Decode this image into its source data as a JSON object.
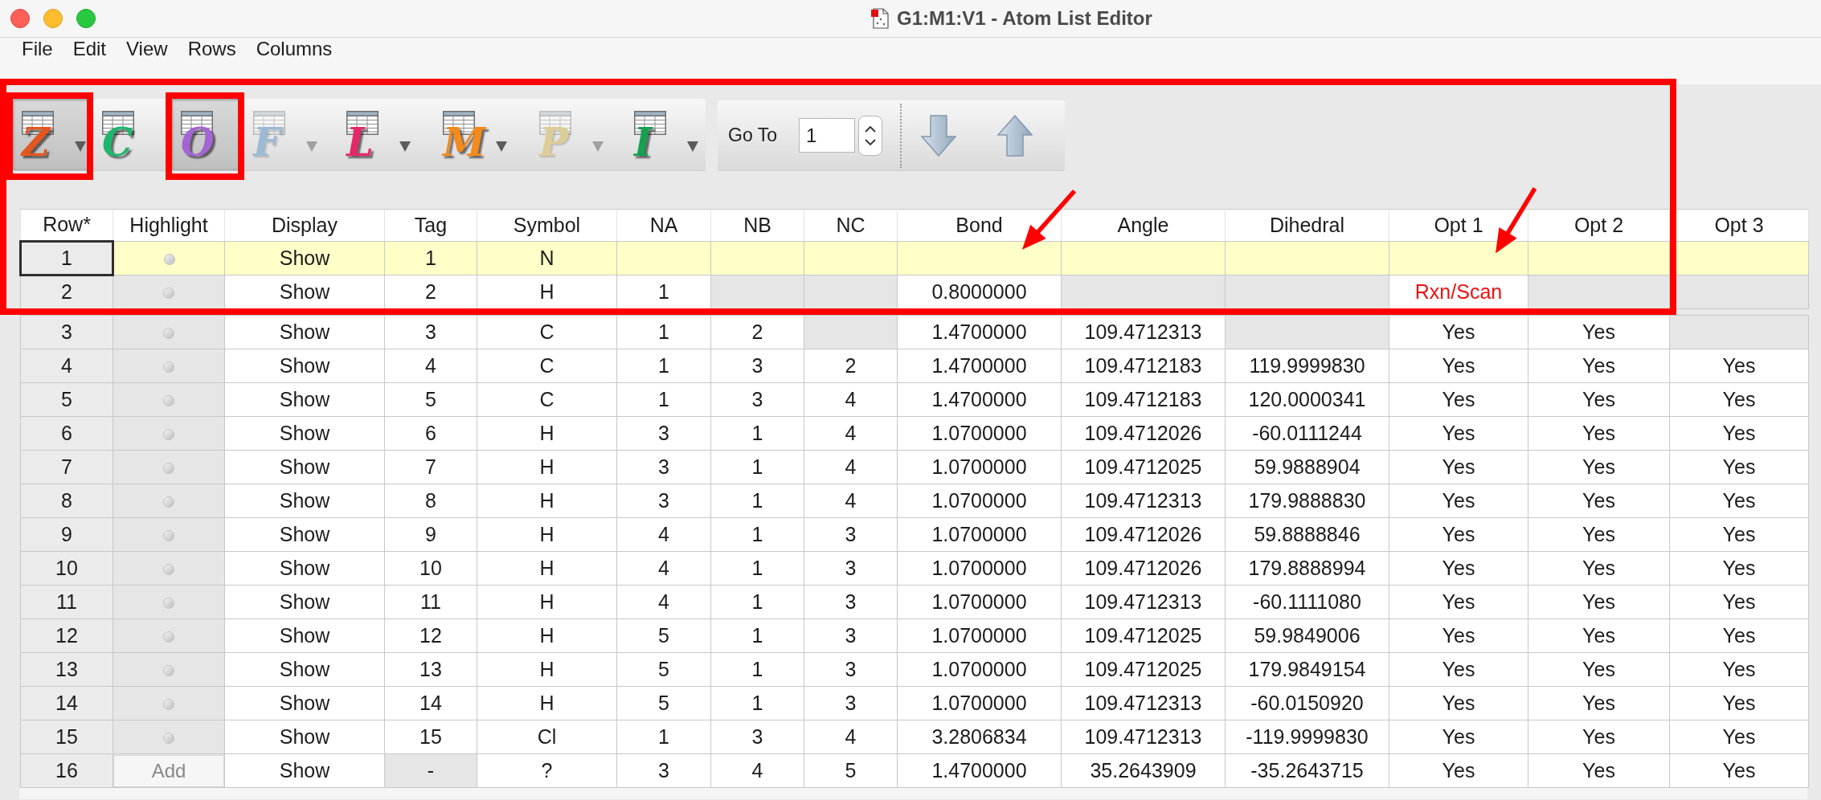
{
  "window": {
    "title": "G1:M1:V1 - Atom List Editor"
  },
  "menu": [
    "File",
    "Edit",
    "View",
    "Rows",
    "Columns"
  ],
  "toolbar": {
    "buttons": [
      {
        "letter": "Z",
        "color": "#e4561f",
        "dropdown": true,
        "pressed": true,
        "disabled": false,
        "annotated": true
      },
      {
        "letter": "C",
        "color": "#1fb56e",
        "dropdown": false,
        "pressed": false,
        "disabled": false,
        "annotated": false
      },
      {
        "letter": "O",
        "color": "#a464d4",
        "dropdown": false,
        "pressed": true,
        "disabled": false,
        "annotated": true
      },
      {
        "letter": "F",
        "color": "#9db9d6",
        "dropdown": true,
        "pressed": false,
        "disabled": true,
        "annotated": false
      },
      {
        "letter": "L",
        "color": "#e6286a",
        "dropdown": true,
        "pressed": false,
        "disabled": false,
        "annotated": false
      },
      {
        "letter": "M",
        "color": "#f28a1c",
        "dropdown": true,
        "pressed": false,
        "disabled": false,
        "annotated": false
      },
      {
        "letter": "P",
        "color": "#dccd96",
        "dropdown": true,
        "pressed": false,
        "disabled": true,
        "annotated": false
      },
      {
        "letter": "I",
        "color": "#17a050",
        "dropdown": true,
        "pressed": false,
        "disabled": false,
        "annotated": false
      }
    ],
    "goto": {
      "label": "Go To",
      "value": "1"
    }
  },
  "table": {
    "columns": [
      "Row*",
      "Highlight",
      "Display",
      "Tag",
      "Symbol",
      "NA",
      "NB",
      "NC",
      "Bond",
      "Angle",
      "Dihedral",
      "Opt 1",
      "Opt 2",
      "Opt 3"
    ],
    "rows": [
      {
        "selected": true,
        "cells": [
          {
            "kind": "number",
            "text": "1"
          },
          {
            "kind": "dot",
            "greyed": false
          },
          {
            "kind": "value",
            "text": "Show",
            "greyed": false
          },
          {
            "kind": "value",
            "text": "1",
            "greyed": false
          },
          {
            "kind": "value",
            "text": "N",
            "greyed": false
          },
          {
            "kind": "value",
            "greyed": false
          },
          {
            "kind": "value",
            "greyed": false
          },
          {
            "kind": "value",
            "greyed": false
          },
          {
            "kind": "value",
            "greyed": false
          },
          {
            "kind": "value",
            "greyed": false
          },
          {
            "kind": "value",
            "greyed": false
          },
          {
            "kind": "value",
            "greyed": false
          },
          {
            "kind": "value",
            "greyed": false
          },
          {
            "kind": "value",
            "greyed": false
          }
        ]
      },
      {
        "selected": false,
        "cells": [
          {
            "kind": "number",
            "text": "2"
          },
          {
            "kind": "dot",
            "greyed": true
          },
          {
            "kind": "value",
            "text": "Show",
            "greyed": false
          },
          {
            "kind": "value",
            "text": "2",
            "greyed": false
          },
          {
            "kind": "value",
            "text": "H",
            "greyed": false
          },
          {
            "kind": "value",
            "text": "1",
            "greyed": false
          },
          {
            "kind": "value",
            "greyed": true
          },
          {
            "kind": "value",
            "greyed": true
          },
          {
            "kind": "value",
            "text": "0.8000000",
            "greyed": false
          },
          {
            "kind": "value",
            "greyed": true
          },
          {
            "kind": "value",
            "greyed": true
          },
          {
            "kind": "value",
            "text": "Rxn/Scan",
            "greyed": false,
            "color": "#ee1111"
          },
          {
            "kind": "value",
            "greyed": true
          },
          {
            "kind": "value",
            "greyed": true
          }
        ]
      },
      {
        "selected": false,
        "cells": [
          {
            "kind": "number",
            "text": "3"
          },
          {
            "kind": "dot",
            "greyed": true
          },
          {
            "kind": "value",
            "text": "Show",
            "greyed": false
          },
          {
            "kind": "value",
            "text": "3",
            "greyed": false
          },
          {
            "kind": "value",
            "text": "C",
            "greyed": false
          },
          {
            "kind": "value",
            "text": "1",
            "greyed": false
          },
          {
            "kind": "value",
            "text": "2",
            "greyed": false
          },
          {
            "kind": "value",
            "greyed": true
          },
          {
            "kind": "value",
            "text": "1.4700000",
            "greyed": false
          },
          {
            "kind": "value",
            "text": "109.4712313",
            "greyed": false
          },
          {
            "kind": "value",
            "greyed": true
          },
          {
            "kind": "value",
            "text": "Yes",
            "greyed": false
          },
          {
            "kind": "value",
            "text": "Yes",
            "greyed": false
          },
          {
            "kind": "value",
            "greyed": true
          }
        ]
      },
      {
        "selected": false,
        "cells": [
          {
            "kind": "number",
            "text": "4"
          },
          {
            "kind": "dot",
            "greyed": true
          },
          {
            "kind": "value",
            "text": "Show",
            "greyed": false
          },
          {
            "kind": "value",
            "text": "4",
            "greyed": false
          },
          {
            "kind": "value",
            "text": "C",
            "greyed": false
          },
          {
            "kind": "value",
            "text": "1",
            "greyed": false
          },
          {
            "kind": "value",
            "text": "3",
            "greyed": false
          },
          {
            "kind": "value",
            "text": "2",
            "greyed": false
          },
          {
            "kind": "value",
            "text": "1.4700000",
            "greyed": false
          },
          {
            "kind": "value",
            "text": "109.4712183",
            "greyed": false
          },
          {
            "kind": "value",
            "text": "119.9999830",
            "greyed": false
          },
          {
            "kind": "value",
            "text": "Yes",
            "greyed": false
          },
          {
            "kind": "value",
            "text": "Yes",
            "greyed": false
          },
          {
            "kind": "value",
            "text": "Yes",
            "greyed": false
          }
        ]
      },
      {
        "selected": false,
        "cells": [
          {
            "kind": "number",
            "text": "5"
          },
          {
            "kind": "dot",
            "greyed": true
          },
          {
            "kind": "value",
            "text": "Show",
            "greyed": false
          },
          {
            "kind": "value",
            "text": "5",
            "greyed": false
          },
          {
            "kind": "value",
            "text": "C",
            "greyed": false
          },
          {
            "kind": "value",
            "text": "1",
            "greyed": false
          },
          {
            "kind": "value",
            "text": "3",
            "greyed": false
          },
          {
            "kind": "value",
            "text": "4",
            "greyed": false
          },
          {
            "kind": "value",
            "text": "1.4700000",
            "greyed": false
          },
          {
            "kind": "value",
            "text": "109.4712183",
            "greyed": false
          },
          {
            "kind": "value",
            "text": "120.0000341",
            "greyed": false
          },
          {
            "kind": "value",
            "text": "Yes",
            "greyed": false
          },
          {
            "kind": "value",
            "text": "Yes",
            "greyed": false
          },
          {
            "kind": "value",
            "text": "Yes",
            "greyed": false
          }
        ]
      },
      {
        "selected": false,
        "cells": [
          {
            "kind": "number",
            "text": "6"
          },
          {
            "kind": "dot",
            "greyed": true
          },
          {
            "kind": "value",
            "text": "Show",
            "greyed": false
          },
          {
            "kind": "value",
            "text": "6",
            "greyed": false
          },
          {
            "kind": "value",
            "text": "H",
            "greyed": false
          },
          {
            "kind": "value",
            "text": "3",
            "greyed": false
          },
          {
            "kind": "value",
            "text": "1",
            "greyed": false
          },
          {
            "kind": "value",
            "text": "4",
            "greyed": false
          },
          {
            "kind": "value",
            "text": "1.0700000",
            "greyed": false
          },
          {
            "kind": "value",
            "text": "109.4712026",
            "greyed": false
          },
          {
            "kind": "value",
            "text": "-60.0111244",
            "greyed": false
          },
          {
            "kind": "value",
            "text": "Yes",
            "greyed": false
          },
          {
            "kind": "value",
            "text": "Yes",
            "greyed": false
          },
          {
            "kind": "value",
            "text": "Yes",
            "greyed": false
          }
        ]
      },
      {
        "selected": false,
        "cells": [
          {
            "kind": "number",
            "text": "7"
          },
          {
            "kind": "dot",
            "greyed": true
          },
          {
            "kind": "value",
            "text": "Show",
            "greyed": false
          },
          {
            "kind": "value",
            "text": "7",
            "greyed": false
          },
          {
            "kind": "value",
            "text": "H",
            "greyed": false
          },
          {
            "kind": "value",
            "text": "3",
            "greyed": false
          },
          {
            "kind": "value",
            "text": "1",
            "greyed": false
          },
          {
            "kind": "value",
            "text": "4",
            "greyed": false
          },
          {
            "kind": "value",
            "text": "1.0700000",
            "greyed": false
          },
          {
            "kind": "value",
            "text": "109.4712025",
            "greyed": false
          },
          {
            "kind": "value",
            "text": "59.9888904",
            "greyed": false
          },
          {
            "kind": "value",
            "text": "Yes",
            "greyed": false
          },
          {
            "kind": "value",
            "text": "Yes",
            "greyed": false
          },
          {
            "kind": "value",
            "text": "Yes",
            "greyed": false
          }
        ]
      },
      {
        "selected": false,
        "cells": [
          {
            "kind": "number",
            "text": "8"
          },
          {
            "kind": "dot",
            "greyed": true
          },
          {
            "kind": "value",
            "text": "Show",
            "greyed": false
          },
          {
            "kind": "value",
            "text": "8",
            "greyed": false
          },
          {
            "kind": "value",
            "text": "H",
            "greyed": false
          },
          {
            "kind": "value",
            "text": "3",
            "greyed": false
          },
          {
            "kind": "value",
            "text": "1",
            "greyed": false
          },
          {
            "kind": "value",
            "text": "4",
            "greyed": false
          },
          {
            "kind": "value",
            "text": "1.0700000",
            "greyed": false
          },
          {
            "kind": "value",
            "text": "109.4712313",
            "greyed": false
          },
          {
            "kind": "value",
            "text": "179.9888830",
            "greyed": false
          },
          {
            "kind": "value",
            "text": "Yes",
            "greyed": false
          },
          {
            "kind": "value",
            "text": "Yes",
            "greyed": false
          },
          {
            "kind": "value",
            "text": "Yes",
            "greyed": false
          }
        ]
      },
      {
        "selected": false,
        "cells": [
          {
            "kind": "number",
            "text": "9"
          },
          {
            "kind": "dot",
            "greyed": true
          },
          {
            "kind": "value",
            "text": "Show",
            "greyed": false
          },
          {
            "kind": "value",
            "text": "9",
            "greyed": false
          },
          {
            "kind": "value",
            "text": "H",
            "greyed": false
          },
          {
            "kind": "value",
            "text": "4",
            "greyed": false
          },
          {
            "kind": "value",
            "text": "1",
            "greyed": false
          },
          {
            "kind": "value",
            "text": "3",
            "greyed": false
          },
          {
            "kind": "value",
            "text": "1.0700000",
            "greyed": false
          },
          {
            "kind": "value",
            "text": "109.4712026",
            "greyed": false
          },
          {
            "kind": "value",
            "text": "59.8888846",
            "greyed": false
          },
          {
            "kind": "value",
            "text": "Yes",
            "greyed": false
          },
          {
            "kind": "value",
            "text": "Yes",
            "greyed": false
          },
          {
            "kind": "value",
            "text": "Yes",
            "greyed": false
          }
        ]
      },
      {
        "selected": false,
        "cells": [
          {
            "kind": "number",
            "text": "10"
          },
          {
            "kind": "dot",
            "greyed": true
          },
          {
            "kind": "value",
            "text": "Show",
            "greyed": false
          },
          {
            "kind": "value",
            "text": "10",
            "greyed": false
          },
          {
            "kind": "value",
            "text": "H",
            "greyed": false
          },
          {
            "kind": "value",
            "text": "4",
            "greyed": false
          },
          {
            "kind": "value",
            "text": "1",
            "greyed": false
          },
          {
            "kind": "value",
            "text": "3",
            "greyed": false
          },
          {
            "kind": "value",
            "text": "1.0700000",
            "greyed": false
          },
          {
            "kind": "value",
            "text": "109.4712026",
            "greyed": false
          },
          {
            "kind": "value",
            "text": "179.8888994",
            "greyed": false
          },
          {
            "kind": "value",
            "text": "Yes",
            "greyed": false
          },
          {
            "kind": "value",
            "text": "Yes",
            "greyed": false
          },
          {
            "kind": "value",
            "text": "Yes",
            "greyed": false
          }
        ]
      },
      {
        "selected": false,
        "cells": [
          {
            "kind": "number",
            "text": "11"
          },
          {
            "kind": "dot",
            "greyed": true
          },
          {
            "kind": "value",
            "text": "Show",
            "greyed": false
          },
          {
            "kind": "value",
            "text": "11",
            "greyed": false
          },
          {
            "kind": "value",
            "text": "H",
            "greyed": false
          },
          {
            "kind": "value",
            "text": "4",
            "greyed": false
          },
          {
            "kind": "value",
            "text": "1",
            "greyed": false
          },
          {
            "kind": "value",
            "text": "3",
            "greyed": false
          },
          {
            "kind": "value",
            "text": "1.0700000",
            "greyed": false
          },
          {
            "kind": "value",
            "text": "109.4712313",
            "greyed": false
          },
          {
            "kind": "value",
            "text": "-60.1111080",
            "greyed": false
          },
          {
            "kind": "value",
            "text": "Yes",
            "greyed": false
          },
          {
            "kind": "value",
            "text": "Yes",
            "greyed": false
          },
          {
            "kind": "value",
            "text": "Yes",
            "greyed": false
          }
        ]
      },
      {
        "selected": false,
        "cells": [
          {
            "kind": "number",
            "text": "12"
          },
          {
            "kind": "dot",
            "greyed": true
          },
          {
            "kind": "value",
            "text": "Show",
            "greyed": false
          },
          {
            "kind": "value",
            "text": "12",
            "greyed": false
          },
          {
            "kind": "value",
            "text": "H",
            "greyed": false
          },
          {
            "kind": "value",
            "text": "5",
            "greyed": false
          },
          {
            "kind": "value",
            "text": "1",
            "greyed": false
          },
          {
            "kind": "value",
            "text": "3",
            "greyed": false
          },
          {
            "kind": "value",
            "text": "1.0700000",
            "greyed": false
          },
          {
            "kind": "value",
            "text": "109.4712025",
            "greyed": false
          },
          {
            "kind": "value",
            "text": "59.9849006",
            "greyed": false
          },
          {
            "kind": "value",
            "text": "Yes",
            "greyed": false
          },
          {
            "kind": "value",
            "text": "Yes",
            "greyed": false
          },
          {
            "kind": "value",
            "text": "Yes",
            "greyed": false
          }
        ]
      },
      {
        "selected": false,
        "cells": [
          {
            "kind": "number",
            "text": "13"
          },
          {
            "kind": "dot",
            "greyed": true
          },
          {
            "kind": "value",
            "text": "Show",
            "greyed": false
          },
          {
            "kind": "value",
            "text": "13",
            "greyed": false
          },
          {
            "kind": "value",
            "text": "H",
            "greyed": false
          },
          {
            "kind": "value",
            "text": "5",
            "greyed": false
          },
          {
            "kind": "value",
            "text": "1",
            "greyed": false
          },
          {
            "kind": "value",
            "text": "3",
            "greyed": false
          },
          {
            "kind": "value",
            "text": "1.0700000",
            "greyed": false
          },
          {
            "kind": "value",
            "text": "109.4712025",
            "greyed": false
          },
          {
            "kind": "value",
            "text": "179.9849154",
            "greyed": false
          },
          {
            "kind": "value",
            "text": "Yes",
            "greyed": false
          },
          {
            "kind": "value",
            "text": "Yes",
            "greyed": false
          },
          {
            "kind": "value",
            "text": "Yes",
            "greyed": false
          }
        ]
      },
      {
        "selected": false,
        "cells": [
          {
            "kind": "number",
            "text": "14"
          },
          {
            "kind": "dot",
            "greyed": true
          },
          {
            "kind": "value",
            "text": "Show",
            "greyed": false
          },
          {
            "kind": "value",
            "text": "14",
            "greyed": false
          },
          {
            "kind": "value",
            "text": "H",
            "greyed": false
          },
          {
            "kind": "value",
            "text": "5",
            "greyed": false
          },
          {
            "kind": "value",
            "text": "1",
            "greyed": false
          },
          {
            "kind": "value",
            "text": "3",
            "greyed": false
          },
          {
            "kind": "value",
            "text": "1.0700000",
            "greyed": false
          },
          {
            "kind": "value",
            "text": "109.4712313",
            "greyed": false
          },
          {
            "kind": "value",
            "text": "-60.0150920",
            "greyed": false
          },
          {
            "kind": "value",
            "text": "Yes",
            "greyed": false
          },
          {
            "kind": "value",
            "text": "Yes",
            "greyed": false
          },
          {
            "kind": "value",
            "text": "Yes",
            "greyed": false
          }
        ]
      },
      {
        "selected": false,
        "cells": [
          {
            "kind": "number",
            "text": "15"
          },
          {
            "kind": "dot",
            "greyed": true
          },
          {
            "kind": "value",
            "text": "Show",
            "greyed": false
          },
          {
            "kind": "value",
            "text": "15",
            "greyed": false
          },
          {
            "kind": "value",
            "text": "Cl",
            "greyed": false
          },
          {
            "kind": "value",
            "text": "1",
            "greyed": false
          },
          {
            "kind": "value",
            "text": "3",
            "greyed": false
          },
          {
            "kind": "value",
            "text": "4",
            "greyed": false
          },
          {
            "kind": "value",
            "text": "3.2806834",
            "greyed": false
          },
          {
            "kind": "value",
            "text": "109.4712313",
            "greyed": false
          },
          {
            "kind": "value",
            "text": "-119.9999830",
            "greyed": false
          },
          {
            "kind": "value",
            "text": "Yes",
            "greyed": false
          },
          {
            "kind": "value",
            "text": "Yes",
            "greyed": false
          },
          {
            "kind": "value",
            "text": "Yes",
            "greyed": false
          }
        ]
      },
      {
        "selected": false,
        "cells": [
          {
            "kind": "number",
            "text": "16"
          },
          {
            "kind": "button",
            "text": "Add"
          },
          {
            "kind": "value",
            "text": "Show",
            "greyed": false
          },
          {
            "kind": "value",
            "text": "-",
            "greyed": true
          },
          {
            "kind": "value",
            "text": "?",
            "greyed": false
          },
          {
            "kind": "value",
            "text": "3",
            "greyed": false
          },
          {
            "kind": "value",
            "text": "4",
            "greyed": false
          },
          {
            "kind": "value",
            "text": "5",
            "greyed": false
          },
          {
            "kind": "value",
            "text": "1.4700000",
            "greyed": false
          },
          {
            "kind": "value",
            "text": "35.2643909",
            "greyed": false
          },
          {
            "kind": "value",
            "text": "-35.2643715",
            "greyed": false
          },
          {
            "kind": "value",
            "text": "Yes",
            "greyed": false
          },
          {
            "kind": "value",
            "text": "Yes",
            "greyed": false
          },
          {
            "kind": "value",
            "text": "Yes",
            "greyed": false
          }
        ]
      }
    ]
  }
}
